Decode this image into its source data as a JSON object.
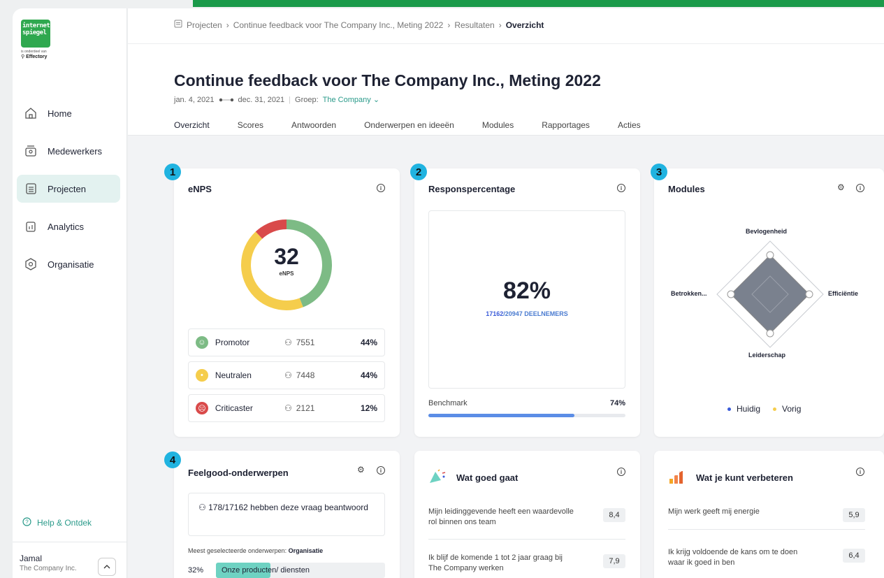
{
  "logo": {
    "line1": "internet",
    "line2": "spiegel",
    "sub": "is onderdeel van",
    "brand": "Effectory"
  },
  "sidebar": {
    "items": [
      {
        "label": "Home",
        "icon": "home-icon"
      },
      {
        "label": "Medewerkers",
        "icon": "people-icon"
      },
      {
        "label": "Projecten",
        "icon": "projects-icon",
        "active": true
      },
      {
        "label": "Analytics",
        "icon": "analytics-icon"
      },
      {
        "label": "Organisatie",
        "icon": "organisation-icon"
      }
    ],
    "help": "Help & Ontdek",
    "user": {
      "name": "Jamal",
      "company": "The Company Inc."
    }
  },
  "breadcrumb": [
    "Projecten",
    "Continue feedback voor The Company Inc., Meting 2022",
    "Resultaten",
    "Overzicht"
  ],
  "page": {
    "title": "Continue feedback voor The Company Inc., Meting 2022",
    "date_start": "jan. 4, 2021",
    "date_end": "dec. 31, 2021",
    "group_label": "Groep:",
    "group_value": "The Company"
  },
  "tabs": [
    "Overzicht",
    "Scores",
    "Antwoorden",
    "Onderwerpen en ideeën",
    "Modules",
    "Rapportages",
    "Acties"
  ],
  "enps": {
    "badge": "1",
    "title": "eNPS",
    "score": "32",
    "score_label": "eNPS",
    "segments": {
      "promotor": 0.44,
      "neutral": 0.44,
      "critic": 0.12
    },
    "colors": {
      "promotor": "#7dbb85",
      "neutral": "#f5cd4c",
      "critic": "#d94a4a"
    },
    "rows": [
      {
        "label": "Promotor",
        "count": "7551",
        "pct": "44%",
        "face": "☺"
      },
      {
        "label": "Neutralen",
        "count": "7448",
        "pct": "44%",
        "face": "😐"
      },
      {
        "label": "Criticaster",
        "count": "2121",
        "pct": "12%",
        "face": "☹"
      }
    ]
  },
  "response": {
    "badge": "2",
    "title": "Responspercentage",
    "value": "82%",
    "participants": "17162",
    "total": "/20947 DEELNEMERS",
    "benchmark_label": "Benchmark",
    "benchmark_value": "74%",
    "benchmark_fraction": 0.74
  },
  "modules": {
    "badge": "3",
    "title": "Modules",
    "axes": {
      "top": "Bevlogenheid",
      "right": "Efficiëntie",
      "bottom": "Leiderschap",
      "left": "Betrokken..."
    },
    "legend": [
      {
        "label": "Huidig",
        "color": "#3a5bd9"
      },
      {
        "label": "Vorig",
        "color": "#f5cd4c"
      }
    ]
  },
  "feelgood": {
    "badge": "4",
    "title": "Feelgood-onderwerpen",
    "answered": "178/17162 hebben deze vraag beantwoord",
    "selected_prefix": "Meest geselecteerde onderwerpen:",
    "selected_value": "Organisatie",
    "row": {
      "pct": "32%",
      "topic": "Onze producten/ diensten"
    }
  },
  "goed": {
    "title": "Wat goed gaat",
    "items": [
      {
        "text": "Mijn leidinggevende heeft een waardevolle rol binnen ons team",
        "score": "8,4"
      },
      {
        "text": "Ik blijf de komende 1 tot 2 jaar graag bij The Company werken",
        "score": "7,9"
      }
    ]
  },
  "verbeteren": {
    "title": "Wat je kunt verbeteren",
    "items": [
      {
        "text": "Mijn werk geeft mij energie",
        "score": "5,9"
      },
      {
        "text": "Ik krijg voldoende de kans om te doen waar ik goed in ben",
        "score": "6,4"
      }
    ]
  }
}
